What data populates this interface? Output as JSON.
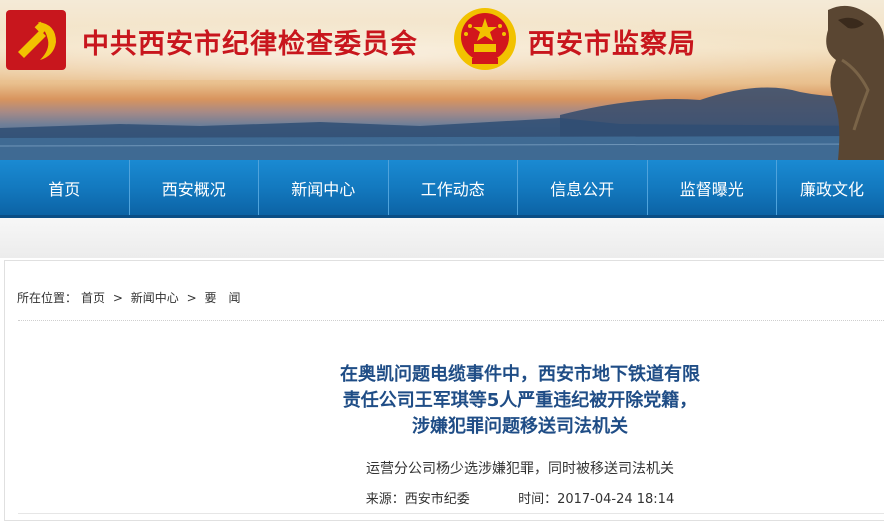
{
  "header": {
    "title_cpc": "中共西安市纪律检查委员会",
    "title_bureau": "西安市监察局",
    "colors": {
      "title": "#c8161d",
      "emblem_gold": "#f2c200"
    }
  },
  "nav": {
    "items": [
      {
        "label": "首页"
      },
      {
        "label": "西安概况"
      },
      {
        "label": "新闻中心"
      },
      {
        "label": "工作动态"
      },
      {
        "label": "信息公开"
      },
      {
        "label": "监督曝光"
      },
      {
        "label": "廉政文化"
      }
    ],
    "colors": {
      "background": "#1379bf",
      "text": "#ffffff"
    }
  },
  "breadcrumb": {
    "prefix": "所在位置：",
    "items": [
      "首页",
      "新闻中心",
      "要　闻"
    ],
    "separator": ">"
  },
  "article": {
    "title_lines": [
      "在奥凯问题电缆事件中，西安市地下铁道有限",
      "责任公司王军琪等5人严重违纪被开除党籍，",
      "涉嫌犯罪问题移送司法机关"
    ],
    "subtitle": "运营分公司杨少选涉嫌犯罪，同时被移送司法机关",
    "source_label": "来源：",
    "source": "西安市纪委",
    "time_label": "时间：",
    "time": "2017-04-24 18:14",
    "colors": {
      "title": "#1f4d86"
    }
  }
}
